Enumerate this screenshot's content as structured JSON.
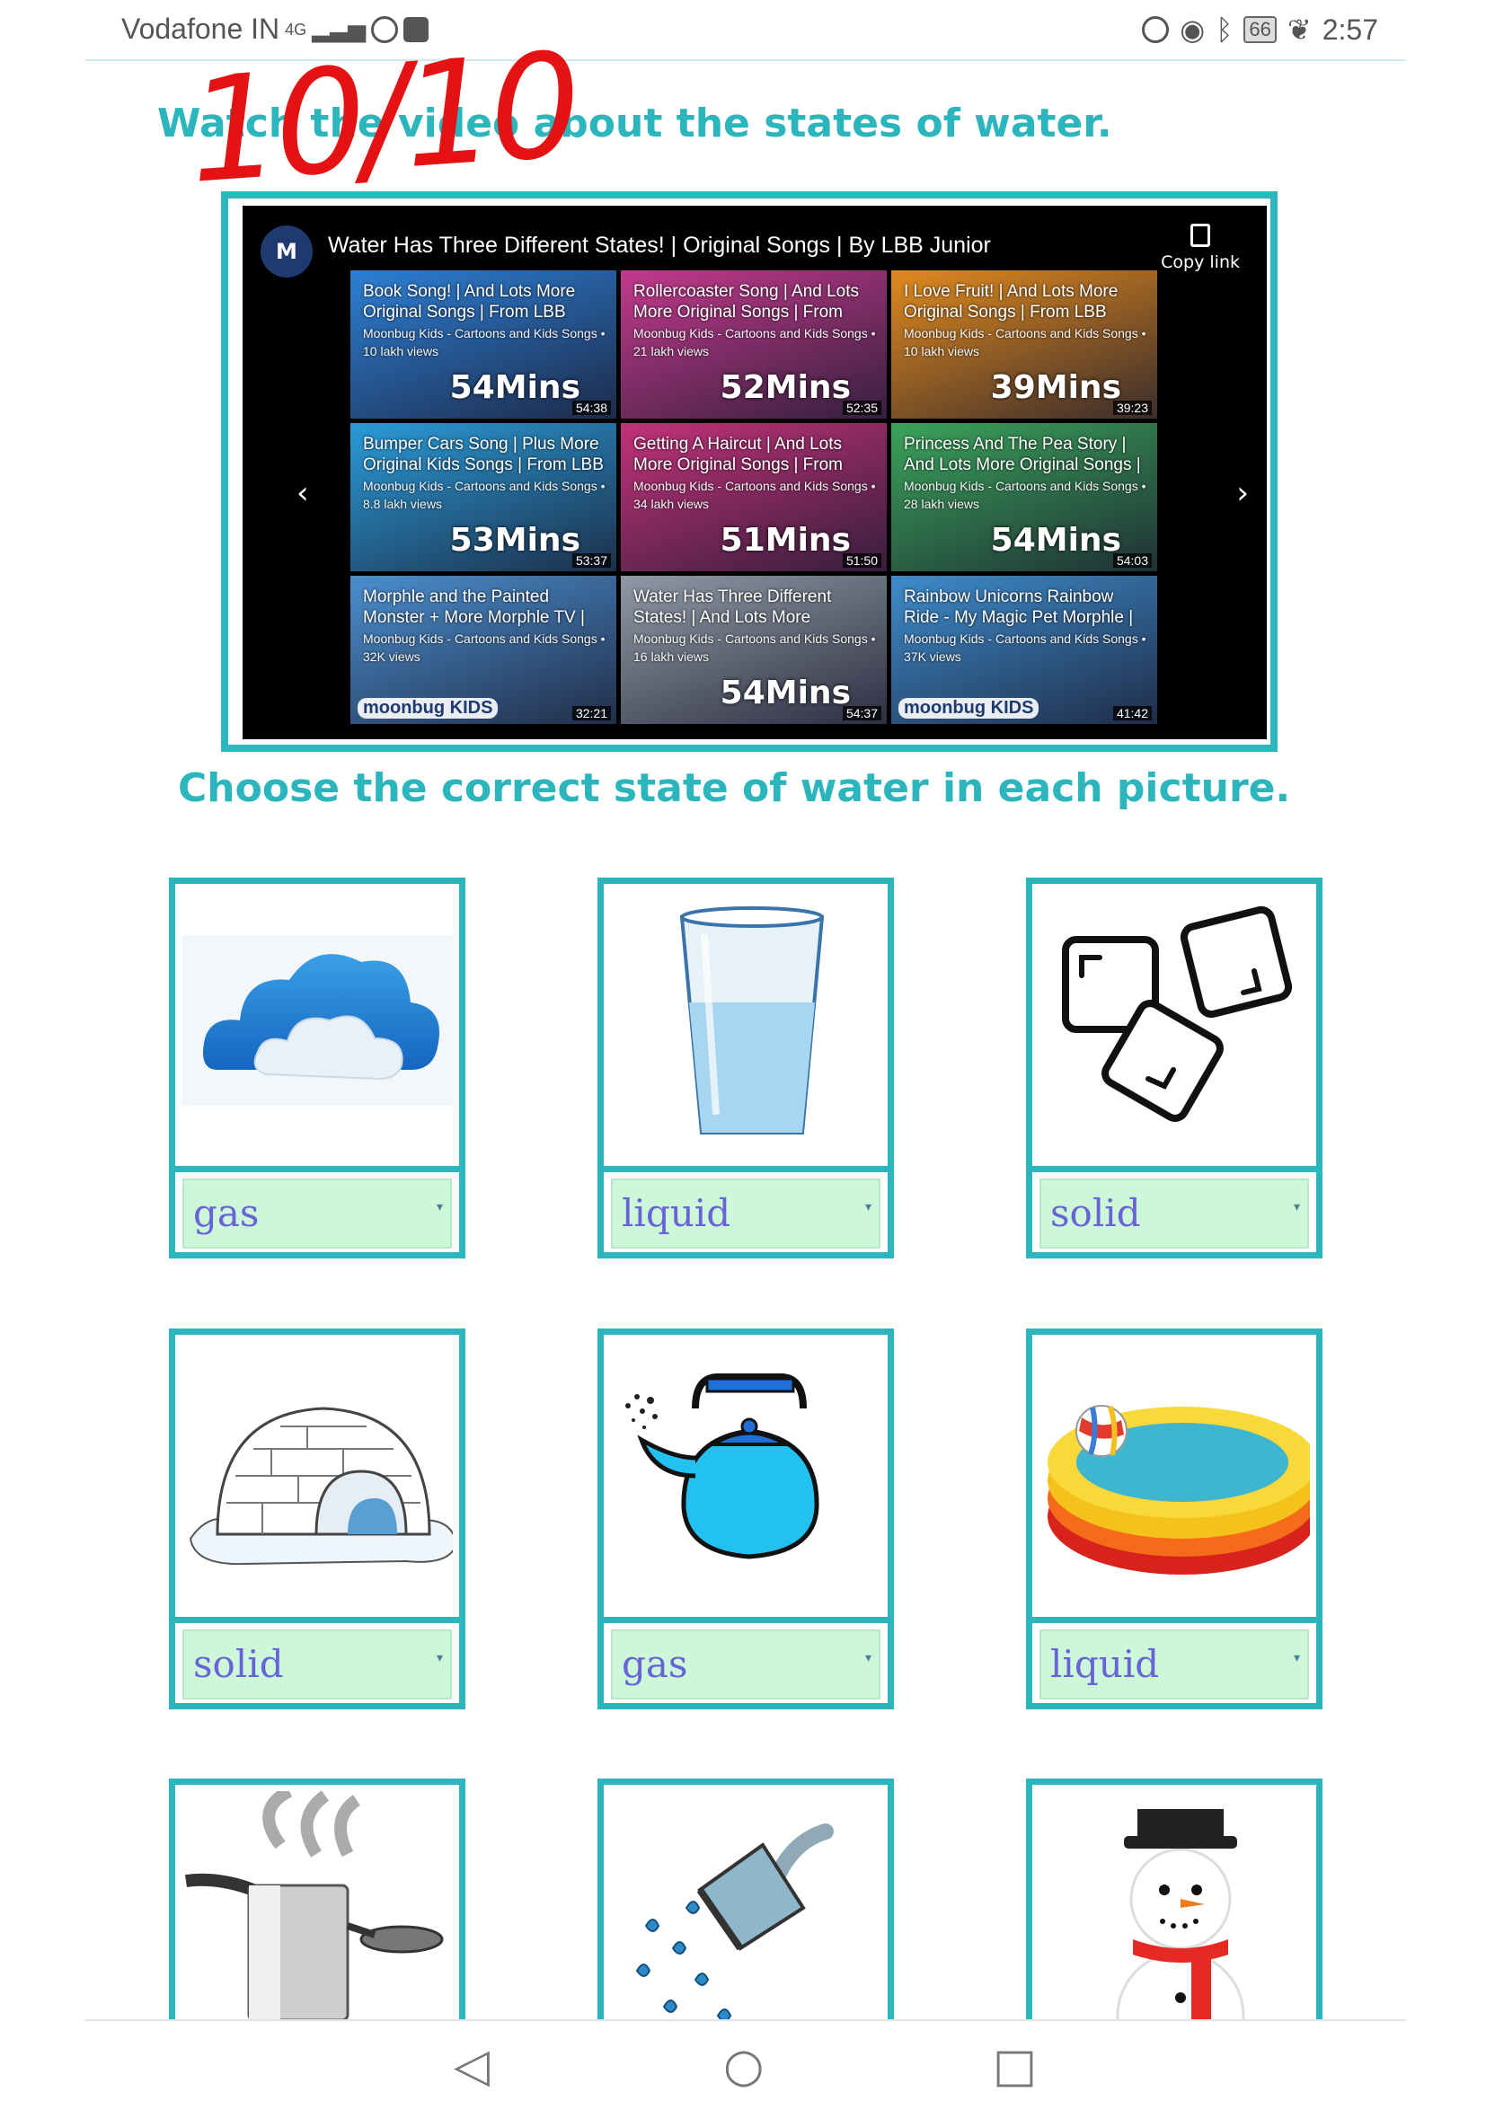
{
  "status_bar": {
    "carrier": "Vodafone IN",
    "network": "4G",
    "battery": "66",
    "time": "2:57"
  },
  "score": "10/10",
  "heading_video": "Watch the video about the states of water.",
  "heading_choose": "Choose the correct state of water in each picture.",
  "video": {
    "title": "Water Has Three Different States! | Original Songs | By LBB Junior",
    "copy_link": "Copy link",
    "thumbnails": [
      {
        "title": "Book Song! | And Lots More Original Songs | From LBB",
        "meta": "Moonbug Kids - Cartoons and Kids Songs • 10 lakh views",
        "badge": "54Mins",
        "duration": "54:38",
        "color": "#2d7fd4"
      },
      {
        "title": "Rollercoaster Song | And Lots More Original Songs | From",
        "meta": "Moonbug Kids - Cartoons and Kids Songs • 21 lakh views",
        "badge": "52Mins",
        "duration": "52:35",
        "color": "#c23a8c"
      },
      {
        "title": "I Love Fruit! | And Lots More Original Songs | From LBB",
        "meta": "Moonbug Kids - Cartoons and Kids Songs • 10 lakh views",
        "badge": "39Mins",
        "duration": "39:23",
        "color": "#e08a1e"
      },
      {
        "title": "Bumper Cars Song | Plus More Original Kids Songs | From LBB",
        "meta": "Moonbug Kids - Cartoons and Kids Songs • 8.8 lakh views",
        "badge": "53Mins",
        "duration": "53:37",
        "color": "#2a9bd8"
      },
      {
        "title": "Getting A Haircut | And Lots More Original Songs | From",
        "meta": "Moonbug Kids - Cartoons and Kids Songs • 34 lakh views",
        "badge": "51Mins",
        "duration": "51:50",
        "color": "#c2327a"
      },
      {
        "title": "Princess And The Pea Story | And Lots More Original Songs |",
        "meta": "Moonbug Kids - Cartoons and Kids Songs • 28 lakh views",
        "badge": "54Mins",
        "duration": "54:03",
        "color": "#3aa35a"
      },
      {
        "title": "Morphle and the Painted Monster + More Morphle TV |",
        "meta": "Moonbug Kids - Cartoons and Kids Songs • 32K views",
        "badge": "",
        "duration": "32:21",
        "color": "#4a8fcf",
        "brand": "moonbug KIDS"
      },
      {
        "title": "Water Has Three Different States! | And Lots More",
        "meta": "Moonbug Kids - Cartoons and Kids Songs • 16 lakh views",
        "badge": "54Mins",
        "duration": "54:37",
        "color": "#8f9aa6"
      },
      {
        "title": "Rainbow Unicorns Rainbow Ride - My Magic Pet Morphle |",
        "meta": "Moonbug Kids - Cartoons and Kids Songs • 37K views",
        "badge": "",
        "duration": "41:42",
        "color": "#3d8ccc",
        "brand": "moonbug KIDS"
      }
    ]
  },
  "cards": [
    {
      "picture": "cloud-icon",
      "answer": "gas"
    },
    {
      "picture": "glass-of-water-icon",
      "answer": "liquid"
    },
    {
      "picture": "ice-cubes-icon",
      "answer": "solid"
    },
    {
      "picture": "igloo-icon",
      "answer": "solid"
    },
    {
      "picture": "kettle-icon",
      "answer": "gas"
    },
    {
      "picture": "pool-icon",
      "answer": "liquid"
    },
    {
      "picture": "steaming-pot-icon",
      "answer": ""
    },
    {
      "picture": "shower-icon",
      "answer": ""
    },
    {
      "picture": "snowman-icon",
      "answer": ""
    }
  ],
  "colors": {
    "accent": "#2bb5bd",
    "dropdown_bg": "#ccf7d8",
    "answer_text": "#6a63d8",
    "score": "#e41212"
  }
}
